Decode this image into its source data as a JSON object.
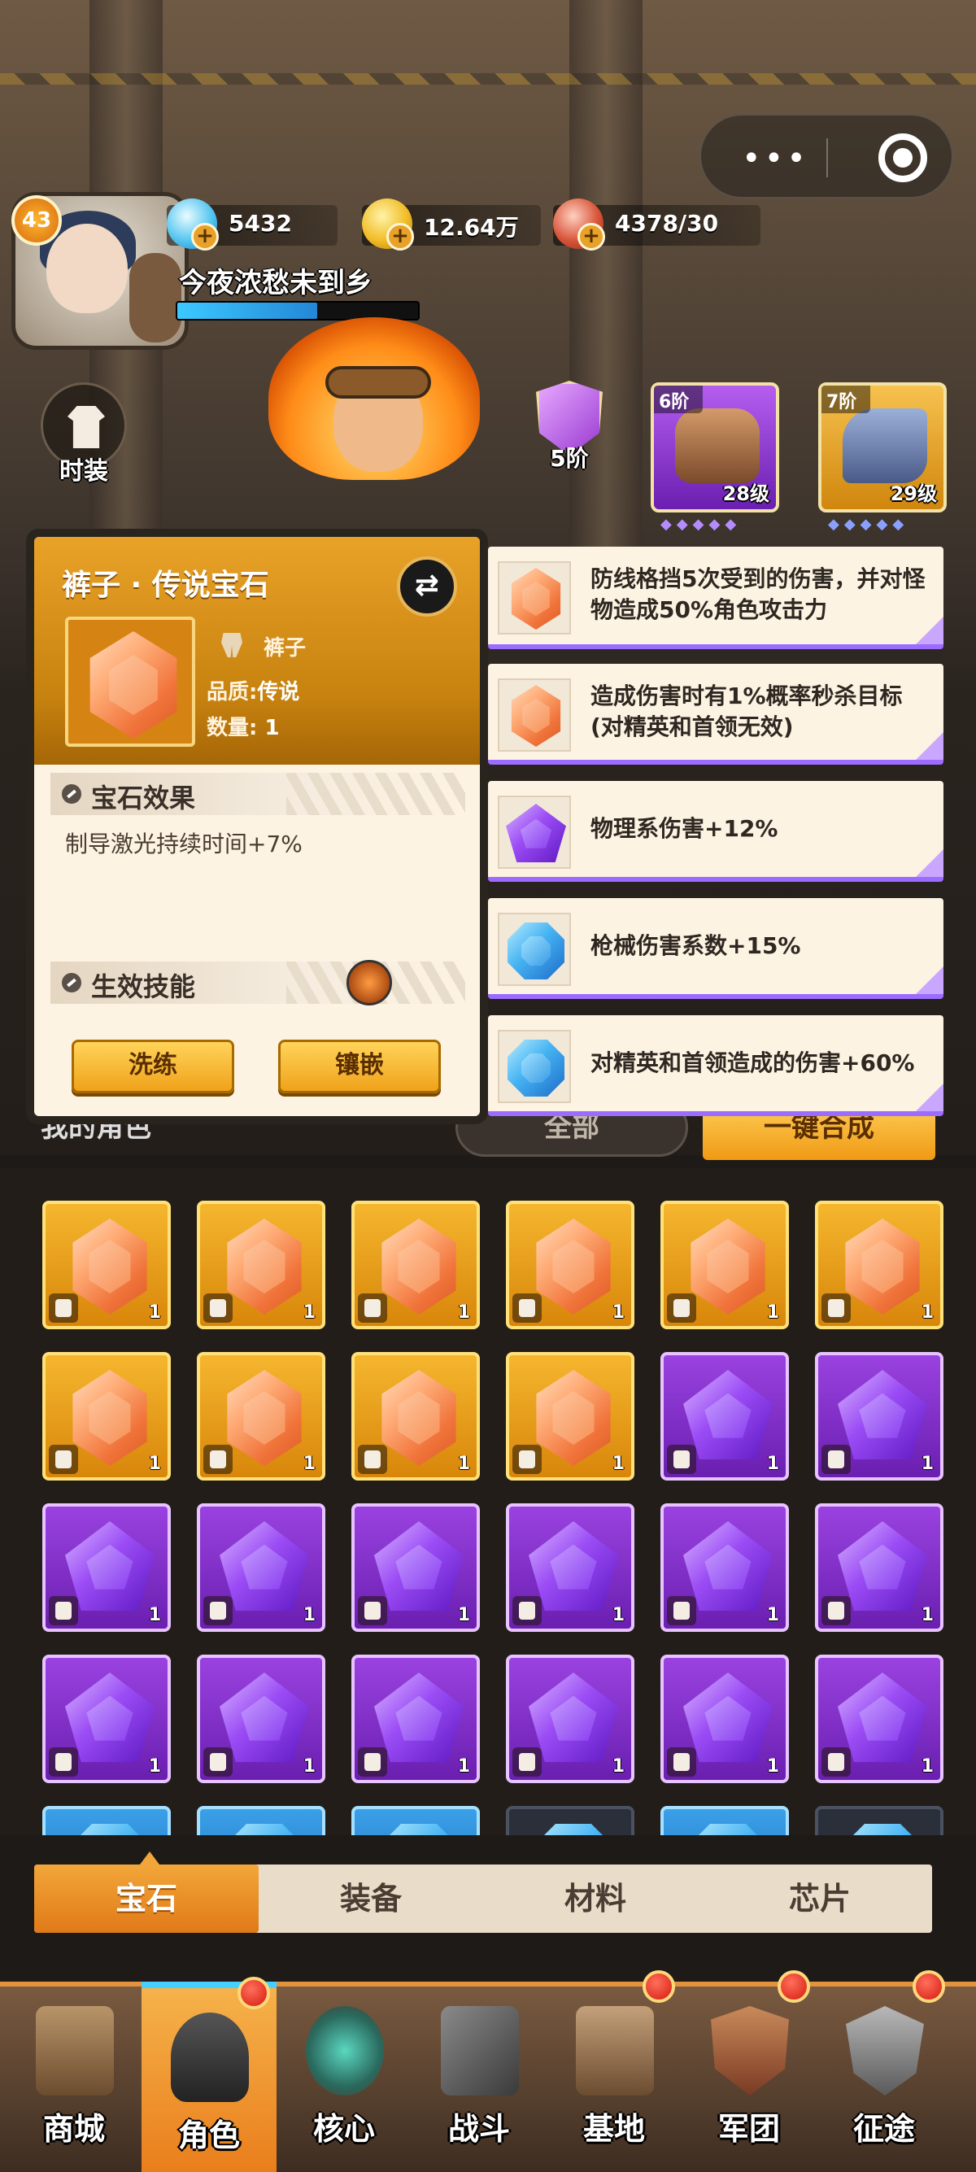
{
  "player": {
    "level": "43",
    "name": "今夜浓愁未到乡",
    "exp_fraction": 0.58
  },
  "resources": [
    {
      "icon": "diamond-icon",
      "value": "5432"
    },
    {
      "icon": "gold-coin-icon",
      "value": "12.64万"
    },
    {
      "icon": "meat-icon",
      "value": "4378/30"
    }
  ],
  "side": {
    "costume_label": "时装",
    "rank_label": "5阶"
  },
  "equipment_slots": [
    {
      "stage": "6阶",
      "level": "28级",
      "color": "#8a3fcf"
    },
    {
      "stage": "7阶",
      "level": "29级",
      "color": "#e2a12a"
    }
  ],
  "gem_popup": {
    "title": "裤子 · 传说宝石",
    "switch_icon": "swap-icon",
    "slot_name": "裤子",
    "quality_label": "品质:",
    "quality_value": "传说",
    "count_label": "数量:",
    "count_value": "1",
    "effect_header": "宝石效果",
    "effect_text": "制导激光持续时间+7%",
    "skill_header": "生效技能",
    "btn_refine": "洗练",
    "btn_inlay": "镶嵌"
  },
  "attributes": [
    {
      "gem": "orange",
      "text": "防线格挡5次受到的伤害，并对怪物造成50%角色攻击力"
    },
    {
      "gem": "orange",
      "text": "造成伤害时有1%概率秒杀目标(对精英和首领无效)"
    },
    {
      "gem": "purple",
      "text": "物理系伤害+12%"
    },
    {
      "gem": "blue",
      "text": "枪械伤害系数+15%"
    },
    {
      "gem": "blue",
      "text": "对精英和首领造成的伤害+60%"
    }
  ],
  "filter": {
    "my_role": "我的角色",
    "all": "全部",
    "one_key": "一键合成"
  },
  "grid": [
    [
      "orange",
      "orange",
      "orange",
      "orange",
      "orange",
      "orange"
    ],
    [
      "orange",
      "orange",
      "orange",
      "orange",
      "purple",
      "purple"
    ],
    [
      "purple",
      "purple",
      "purple",
      "purple",
      "purple",
      "purple"
    ],
    [
      "purple",
      "purple",
      "purple",
      "purple",
      "purple",
      "purple"
    ],
    [
      "blue",
      "blue",
      "blue",
      "dark",
      "blue",
      "dark"
    ]
  ],
  "grid_count": "1",
  "tabs": [
    "宝石",
    "装备",
    "材料",
    "芯片"
  ],
  "nav": [
    {
      "label": "商城",
      "icon": "shop-icon",
      "dot": false
    },
    {
      "label": "角色",
      "icon": "character-icon",
      "dot": true,
      "active": true
    },
    {
      "label": "核心",
      "icon": "core-icon",
      "dot": false
    },
    {
      "label": "战斗",
      "icon": "battle-icon",
      "dot": false
    },
    {
      "label": "基地",
      "icon": "base-icon",
      "dot": true
    },
    {
      "label": "军团",
      "icon": "legion-icon",
      "dot": true
    },
    {
      "label": "征途",
      "icon": "journey-icon",
      "dot": true
    }
  ]
}
